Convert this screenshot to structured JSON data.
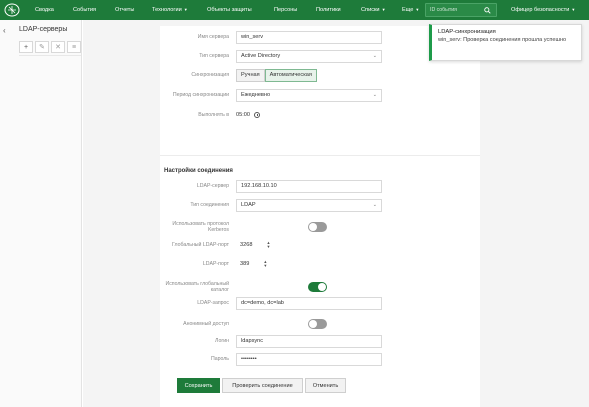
{
  "nav": {
    "items": [
      {
        "label": "Сводка",
        "caret": false
      },
      {
        "label": "События",
        "caret": false
      },
      {
        "label": "Отчеты",
        "caret": false
      },
      {
        "label": "Технологии",
        "caret": true
      },
      {
        "label": "Объекты защиты",
        "caret": false
      },
      {
        "label": "Персоны",
        "caret": false
      },
      {
        "label": "Политики",
        "caret": false
      },
      {
        "label": "Списки",
        "caret": true
      },
      {
        "label": "Еще",
        "caret": true
      }
    ],
    "search_placeholder": "ID события",
    "user_menu": "Офицер безопасности",
    "brand_color": "#1e7b3a"
  },
  "sidebar": {
    "title": "LDAP-серверы",
    "toolbar": [
      {
        "icon": "plus-icon",
        "glyph": "+"
      },
      {
        "icon": "pencil-icon",
        "glyph": "✎"
      },
      {
        "icon": "close-icon",
        "glyph": "✕"
      },
      {
        "icon": "list-icon",
        "glyph": "≡"
      }
    ]
  },
  "form": {
    "server_name_label": "Имя сервера",
    "server_name_value": "win_serv",
    "server_type_label": "Тип сервера",
    "server_type_value": "Active Directory",
    "sync_label": "Синхронизация",
    "sync_manual": "Ручная",
    "sync_auto": "Автоматическая",
    "sync_period_label": "Период синхронизации",
    "sync_period_value": "Ежедневно",
    "execute_at_label": "Выполнять в",
    "execute_at_value": "05:00",
    "section_title": "Настройки соединения",
    "ldap_server_label": "LDAP-сервер",
    "ldap_server_value": "192.168.10.10",
    "conn_type_label": "Тип соединения",
    "conn_type_value": "LDAP",
    "kerberos_label": "Использовать протокол Kerberos",
    "kerberos_on": false,
    "global_ldap_port_label": "Глобальный LDAP-порт",
    "global_ldap_port_value": "3268",
    "ldap_port_label": "LDAP-порт",
    "ldap_port_value": "389",
    "global_catalog_label": "Использовать глобальный каталог",
    "global_catalog_on": true,
    "ldap_query_label": "LDAP-запрос",
    "ldap_query_value": "dc=demo, dc=lab",
    "anon_access_label": "Анонимный доступ",
    "anon_access_on": false,
    "login_label": "Логин",
    "login_value": "ldapsync",
    "password_label": "Пароль",
    "password_value": "••••••••"
  },
  "buttons": {
    "save": "Сохранить",
    "test": "Проверить соединение",
    "cancel": "Отменить"
  },
  "toast": {
    "title": "LDAP-синхронизация",
    "message": "win_serv: Проверка соединения прошла успешно"
  }
}
